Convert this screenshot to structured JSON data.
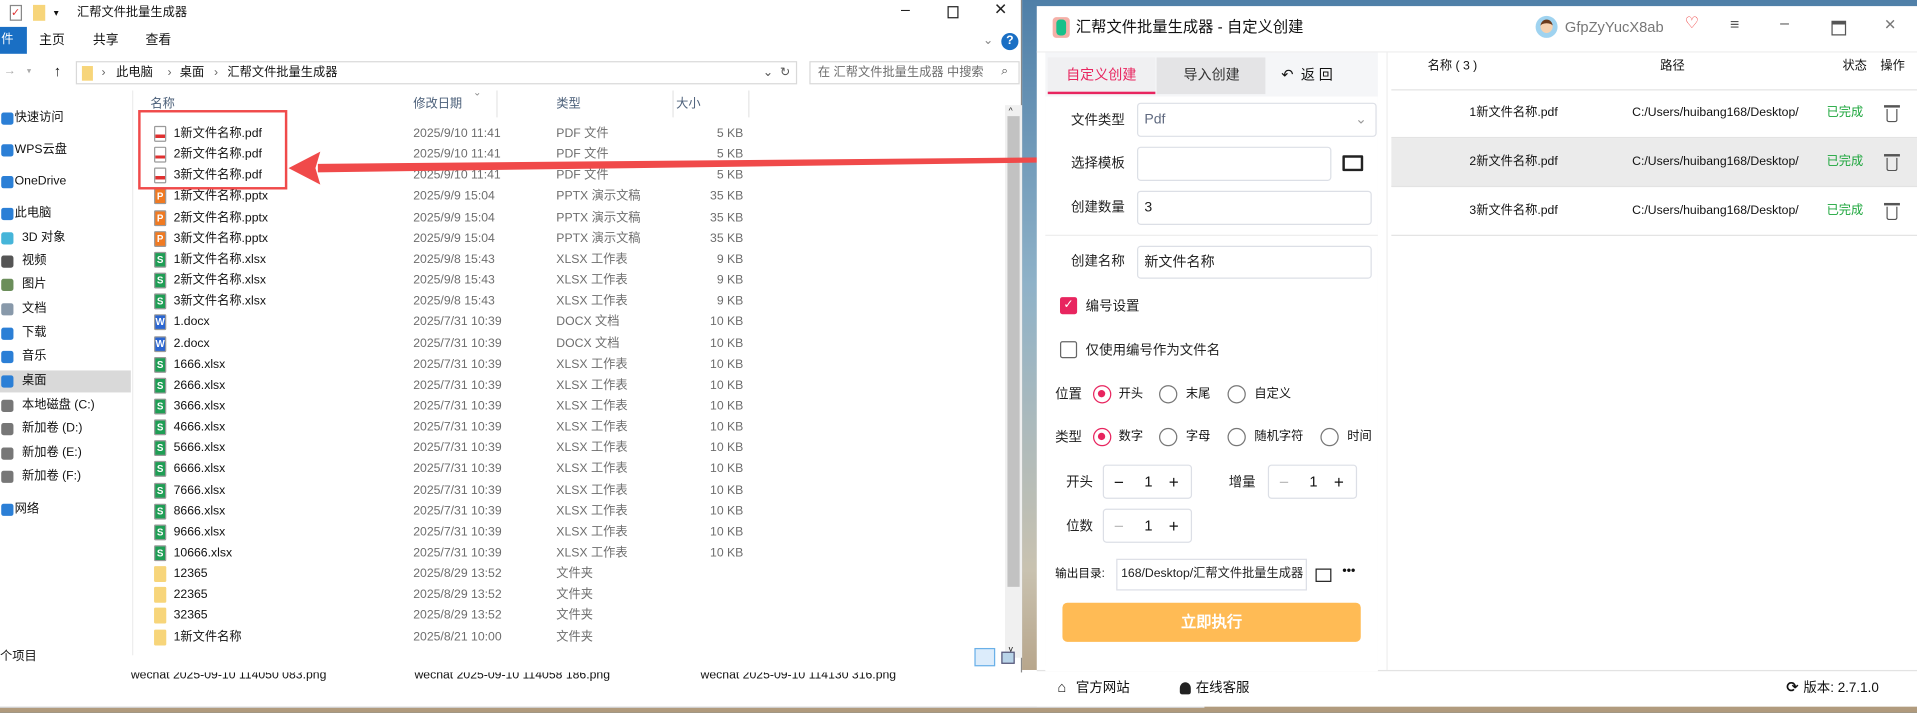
{
  "explorer": {
    "title": "汇帮文件批量生成器",
    "ribbon_tabs": [
      "件",
      "主页",
      "共享",
      "查看"
    ],
    "breadcrumb": [
      "此电脑",
      "桌面",
      "汇帮文件批量生成器"
    ],
    "search_placeholder": "在 汇帮文件批量生成器 中搜索",
    "columns": [
      "名称",
      "修改日期",
      "类型",
      "大小"
    ],
    "sidebar": [
      "快速访问",
      "WPS云盘",
      "OneDrive",
      "此电脑",
      "3D 对象",
      "视频",
      "图片",
      "文档",
      "下载",
      "音乐",
      "桌面",
      "本地磁盘 (C:)",
      "新加卷 (D:)",
      "新加卷 (E:)",
      "新加卷 (F:)",
      "网络"
    ],
    "selected_sidebar": "桌面",
    "files": [
      {
        "name": "1新文件名称.pdf",
        "date": "2025/9/10 11:41",
        "type": "PDF 文件",
        "size": "5 KB",
        "icon": "pdf"
      },
      {
        "name": "2新文件名称.pdf",
        "date": "2025/9/10 11:41",
        "type": "PDF 文件",
        "size": "5 KB",
        "icon": "pdf"
      },
      {
        "name": "3新文件名称.pdf",
        "date": "2025/9/10 11:41",
        "type": "PDF 文件",
        "size": "5 KB",
        "icon": "pdf"
      },
      {
        "name": "1新文件名称.pptx",
        "date": "2025/9/9 15:04",
        "type": "PPTX 演示文稿",
        "size": "35 KB",
        "icon": "pptx"
      },
      {
        "name": "2新文件名称.pptx",
        "date": "2025/9/9 15:04",
        "type": "PPTX 演示文稿",
        "size": "35 KB",
        "icon": "pptx"
      },
      {
        "name": "3新文件名称.pptx",
        "date": "2025/9/9 15:04",
        "type": "PPTX 演示文稿",
        "size": "35 KB",
        "icon": "pptx"
      },
      {
        "name": "1新文件名称.xlsx",
        "date": "2025/9/8 15:43",
        "type": "XLSX 工作表",
        "size": "9 KB",
        "icon": "xlsx"
      },
      {
        "name": "2新文件名称.xlsx",
        "date": "2025/9/8 15:43",
        "type": "XLSX 工作表",
        "size": "9 KB",
        "icon": "xlsx"
      },
      {
        "name": "3新文件名称.xlsx",
        "date": "2025/9/8 15:43",
        "type": "XLSX 工作表",
        "size": "9 KB",
        "icon": "xlsx"
      },
      {
        "name": "1.docx",
        "date": "2025/7/31 10:39",
        "type": "DOCX 文档",
        "size": "10 KB",
        "icon": "docx"
      },
      {
        "name": "2.docx",
        "date": "2025/7/31 10:39",
        "type": "DOCX 文档",
        "size": "10 KB",
        "icon": "docx"
      },
      {
        "name": "1666.xlsx",
        "date": "2025/7/31 10:39",
        "type": "XLSX 工作表",
        "size": "10 KB",
        "icon": "xlsx"
      },
      {
        "name": "2666.xlsx",
        "date": "2025/7/31 10:39",
        "type": "XLSX 工作表",
        "size": "10 KB",
        "icon": "xlsx"
      },
      {
        "name": "3666.xlsx",
        "date": "2025/7/31 10:39",
        "type": "XLSX 工作表",
        "size": "10 KB",
        "icon": "xlsx"
      },
      {
        "name": "4666.xlsx",
        "date": "2025/7/31 10:39",
        "type": "XLSX 工作表",
        "size": "10 KB",
        "icon": "xlsx"
      },
      {
        "name": "5666.xlsx",
        "date": "2025/7/31 10:39",
        "type": "XLSX 工作表",
        "size": "10 KB",
        "icon": "xlsx"
      },
      {
        "name": "6666.xlsx",
        "date": "2025/7/31 10:39",
        "type": "XLSX 工作表",
        "size": "10 KB",
        "icon": "xlsx"
      },
      {
        "name": "7666.xlsx",
        "date": "2025/7/31 10:39",
        "type": "XLSX 工作表",
        "size": "10 KB",
        "icon": "xlsx"
      },
      {
        "name": "8666.xlsx",
        "date": "2025/7/31 10:39",
        "type": "XLSX 工作表",
        "size": "10 KB",
        "icon": "xlsx"
      },
      {
        "name": "9666.xlsx",
        "date": "2025/7/31 10:39",
        "type": "XLSX 工作表",
        "size": "10 KB",
        "icon": "xlsx"
      },
      {
        "name": "10666.xlsx",
        "date": "2025/7/31 10:39",
        "type": "XLSX 工作表",
        "size": "10 KB",
        "icon": "xlsx"
      },
      {
        "name": "12365",
        "date": "2025/8/29 13:52",
        "type": "文件夹",
        "size": "",
        "icon": "folder"
      },
      {
        "name": "22365",
        "date": "2025/8/29 13:52",
        "type": "文件夹",
        "size": "",
        "icon": "folder"
      },
      {
        "name": "32365",
        "date": "2025/8/29 13:52",
        "type": "文件夹",
        "size": "",
        "icon": "folder"
      },
      {
        "name": "1新文件名称",
        "date": "2025/8/21 10:00",
        "type": "文件夹",
        "size": "",
        "icon": "folder"
      }
    ],
    "status": "个项目"
  },
  "background_window": {
    "files": [
      "wechat 2025-09-10 114050 083.png",
      "wechat 2025-09-10 114058 186.png",
      "wechat 2025-09-10 114130 316.png"
    ]
  },
  "app": {
    "title": "汇帮文件批量生成器 - 自定义创建",
    "username": "GfpZyYucX8ab",
    "tabs": [
      "自定义创建",
      "导入创建"
    ],
    "back_label": "返 回",
    "file_type": {
      "label": "文件类型",
      "value": "Pdf"
    },
    "template": {
      "label": "选择模板",
      "value": ""
    },
    "count": {
      "label": "创建数量",
      "value": "3"
    },
    "name": {
      "label": "创建名称",
      "value": "新文件名称"
    },
    "numbering": {
      "label": "编号设置",
      "checked": true
    },
    "only_number": {
      "label": "仅使用编号作为文件名",
      "checked": false
    },
    "position": {
      "label": "位置",
      "options": [
        "开头",
        "末尾",
        "自定义"
      ],
      "selected": "开头"
    },
    "num_type": {
      "label": "类型",
      "options": [
        "数字",
        "字母",
        "随机字符",
        "时间"
      ],
      "selected": "数字"
    },
    "start": {
      "label": "开头",
      "value": "1"
    },
    "increment": {
      "label": "增量",
      "value": "1"
    },
    "digits": {
      "label": "位数",
      "value": "1"
    },
    "output": {
      "label": "输出目录:",
      "value": "168/Desktop/汇帮文件批量生成器"
    },
    "run_label": "立即执行",
    "table": {
      "headers": [
        "名称 ( 3 )",
        "路径",
        "状态",
        "操作"
      ],
      "rows": [
        {
          "name": "1新文件名称.pdf",
          "path": "C:/Users/huibang168/Desktop/",
          "status": "已完成"
        },
        {
          "name": "2新文件名称.pdf",
          "path": "C:/Users/huibang168/Desktop/",
          "status": "已完成"
        },
        {
          "name": "3新文件名称.pdf",
          "path": "C:/Users/huibang168/Desktop/",
          "status": "已完成"
        }
      ]
    },
    "footer": {
      "website": "官方网站",
      "support": "在线客服",
      "version": "版本:  2.7.1.0"
    },
    "colors": {
      "accent": "#e8255f",
      "run_button": "#ffbb55",
      "done": "#1aa53a",
      "annotation": "#f04a4a"
    }
  }
}
